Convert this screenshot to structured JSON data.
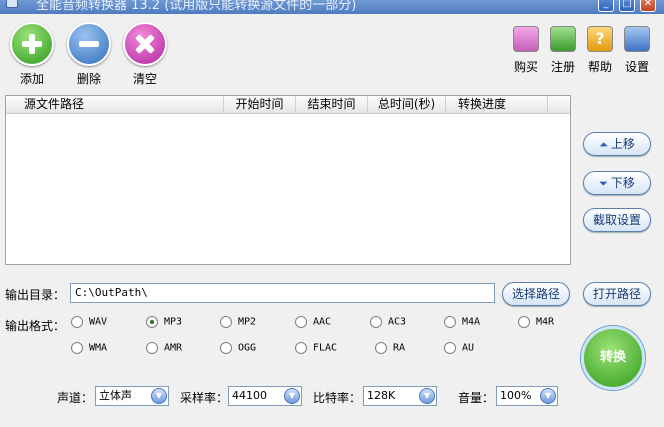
{
  "window": {
    "title": "全能音频转换器 13.2 (试用版只能转换源文件的一部分)"
  },
  "actions": {
    "add": "添加",
    "remove": "删除",
    "clear": "清空"
  },
  "tools": {
    "buy": "购买",
    "register": "注册",
    "help": "帮助",
    "settings": "设置"
  },
  "table": {
    "columns": [
      "源文件路径",
      "开始时间",
      "结束时间",
      "总时间(秒)",
      "转换进度"
    ]
  },
  "side": {
    "move_up": "上移",
    "move_down": "下移",
    "clip_settings": "截取设置"
  },
  "output": {
    "dir_label": "输出目录：",
    "dir_value": "C:\\OutPath\\",
    "choose_path": "选择路径",
    "open_path": "打开路径"
  },
  "format": {
    "label": "输出格式：",
    "options": [
      "WAV",
      "MP3",
      "MP2",
      "AAC",
      "AC3",
      "M4A",
      "M4R",
      "WMA",
      "AMR",
      "OGG",
      "FLAC",
      "RA",
      "AU"
    ],
    "selected": "MP3"
  },
  "convert": "转换",
  "audio": {
    "channel_label": "声道：",
    "channel_value": "立体声",
    "sample_label": "采样率：",
    "sample_value": "44100",
    "bitrate_label": "比特率：",
    "bitrate_value": "128K",
    "volume_label": "音量：",
    "volume_value": "100%"
  }
}
